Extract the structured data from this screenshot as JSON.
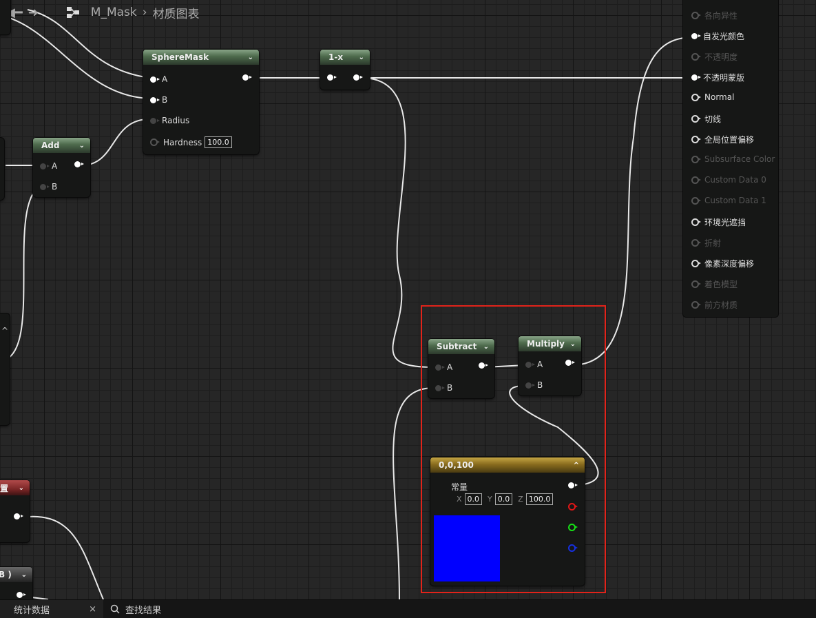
{
  "breadcrumb": {
    "asset": "M_Mask",
    "graph": "材质图表"
  },
  "nodes": {
    "spheremask": {
      "title": "SphereMask",
      "pin_a": "A",
      "pin_b": "B",
      "pin_radius": "Radius",
      "pin_hardness": "Hardness",
      "hardness_value": "100.0"
    },
    "oneminus": {
      "title": "1-x"
    },
    "add": {
      "title": "Add",
      "pin_a": "A",
      "pin_b": "B"
    },
    "subtract": {
      "title": "Subtract",
      "pin_a": "A",
      "pin_b": "B"
    },
    "multiply": {
      "title": "Multiply",
      "pin_a": "A",
      "pin_b": "B"
    },
    "constant": {
      "title": "0,0,100",
      "label": "常量",
      "x_label": "X",
      "x": "0.0",
      "y_label": "Y",
      "y": "0.0",
      "z_label": "Z",
      "z": "100.0",
      "swatch_color": "#0000ff"
    },
    "partial_left_red": {
      "title_fragment": "置"
    },
    "partial_left_bottom": {
      "title_fragment": "B )"
    }
  },
  "result_pins": [
    {
      "label": "各向异性",
      "enabled": false
    },
    {
      "label": "自发光颜色",
      "enabled": true,
      "connected": true
    },
    {
      "label": "不透明度",
      "enabled": false
    },
    {
      "label": "不透明蒙版",
      "enabled": true,
      "connected": true
    },
    {
      "label": "Normal",
      "enabled": true
    },
    {
      "label": "切线",
      "enabled": true
    },
    {
      "label": "全局位置偏移",
      "enabled": true
    },
    {
      "label": "Subsurface Color",
      "enabled": false
    },
    {
      "label": "Custom Data 0",
      "enabled": false
    },
    {
      "label": "Custom Data 1",
      "enabled": false
    },
    {
      "label": "环境光遮挡",
      "enabled": true
    },
    {
      "label": "折射",
      "enabled": false
    },
    {
      "label": "像素深度偏移",
      "enabled": true
    },
    {
      "label": "着色模型",
      "enabled": false
    },
    {
      "label": "前方材质",
      "enabled": false
    }
  ],
  "bottom_tabs": {
    "stats": "统计数据",
    "close": "×",
    "find": "查找结果"
  },
  "colors": {
    "highlight": "#e2231a",
    "material_node": "#5a7a59",
    "constant_node": "#a08528"
  }
}
